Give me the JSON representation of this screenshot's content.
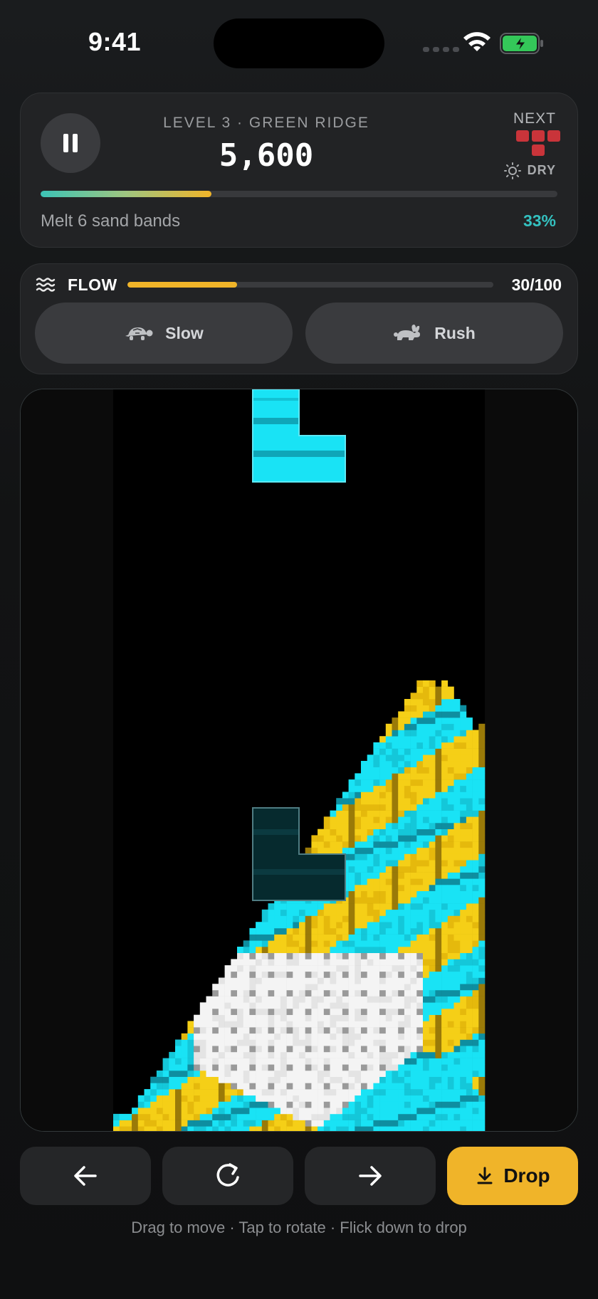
{
  "status_bar": {
    "time": "9:41"
  },
  "header": {
    "level_label": "LEVEL 3 · GREEN RIDGE",
    "score": "5,600",
    "next_label": "NEXT",
    "next_piece_color": "#c9343a",
    "weather_icon": "sun-icon",
    "weather_label": "DRY",
    "progress_percent": 33,
    "goal_text": "Melt 6 sand bands",
    "goal_percent_text": "33%"
  },
  "flow": {
    "label": "FLOW",
    "value": 30,
    "max": 100,
    "count_text": "30/100",
    "slow_label": "Slow",
    "rush_label": "Rush"
  },
  "board": {
    "sand_colors": {
      "cyan": "#19e3f5",
      "yellow": "#f5cf17",
      "white": "#f2f2f2"
    },
    "falling_piece": "L",
    "falling_piece_color": "#19e3f5"
  },
  "controls": {
    "drop_label": "Drop"
  },
  "hint": "Drag to move · Tap to rotate · Flick down to drop",
  "colors": {
    "accent": "#f0b429",
    "teal": "#34c1c0",
    "card_bg": "#222325"
  }
}
